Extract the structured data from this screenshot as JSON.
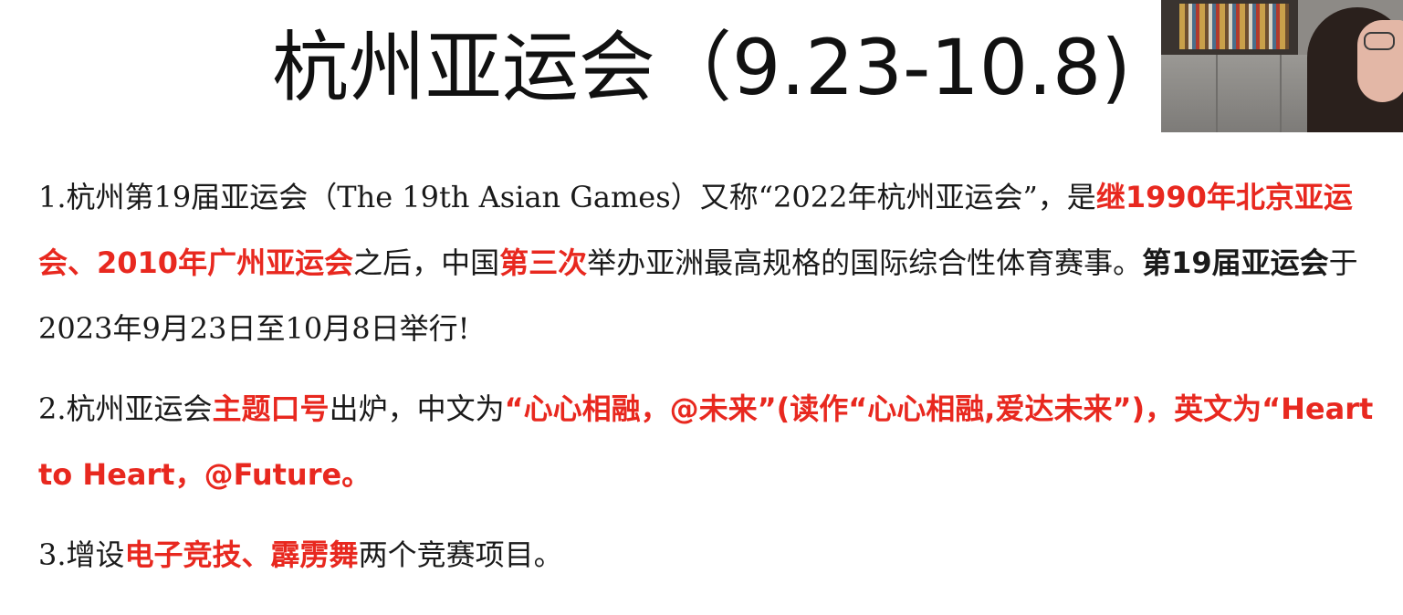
{
  "slide": {
    "title": "杭州亚运会（9.23-10.8)",
    "colors": {
      "highlight": "#e8281f",
      "text": "#1a1a1a",
      "background": "#ffffff"
    },
    "p1": {
      "s1": "1.杭州第19届亚运会（The 19th Asian Games）又称“2022年杭州亚运会”，是",
      "s2": "继1990年北京亚运会、2010年广州亚运会",
      "s3": "之后，中国",
      "s4": "第三次",
      "s5": "举办亚洲最高规格的国际综合性体育赛事。",
      "s6": "第19届亚运会",
      "s7": "于2023年9月23日至10月8日举行!"
    },
    "p2": {
      "s1": "2.杭州亚运会",
      "s2": "主题口号",
      "s3": "出炉，中文为",
      "s4": "“心心相融，@未来”(读作“心心相融,爱达未来”)，英文为“Heart to Heart，@Future。"
    },
    "p3": {
      "s1": "3.增设",
      "s2": "电子竞技、霹雳舞",
      "s3": "两个竞赛项目。"
    }
  }
}
